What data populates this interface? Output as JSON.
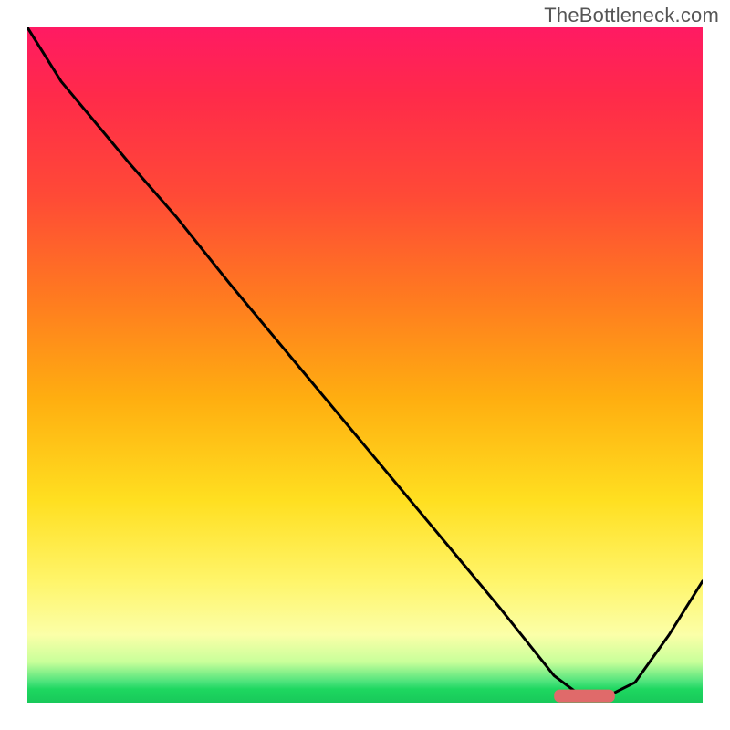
{
  "watermark": "TheBottleneck.com",
  "chart_data": {
    "type": "line",
    "title": "",
    "xlabel": "",
    "ylabel": "",
    "xlim": [
      0,
      100
    ],
    "ylim": [
      0,
      100
    ],
    "grid": false,
    "legend": false,
    "series": [
      {
        "name": "bottleneck-curve",
        "x": [
          0,
          5,
          15,
          22,
          30,
          40,
          50,
          60,
          70,
          78,
          82,
          86,
          90,
          95,
          100
        ],
        "y": [
          100,
          92,
          80,
          72,
          62,
          50,
          38,
          26,
          14,
          4,
          1,
          1,
          3,
          10,
          18
        ]
      }
    ],
    "annotations": [
      {
        "name": "optimal-band",
        "shape": "rounded-bar",
        "x_start": 78,
        "x_end": 87,
        "y": 1,
        "color": "#e06a6a"
      }
    ],
    "background_gradient_stops": [
      {
        "pos": 0.0,
        "color": "#ff1a63"
      },
      {
        "pos": 0.1,
        "color": "#ff2a4a"
      },
      {
        "pos": 0.25,
        "color": "#ff4a36"
      },
      {
        "pos": 0.4,
        "color": "#ff7a20"
      },
      {
        "pos": 0.55,
        "color": "#ffae10"
      },
      {
        "pos": 0.7,
        "color": "#ffdf20"
      },
      {
        "pos": 0.82,
        "color": "#fff56a"
      },
      {
        "pos": 0.9,
        "color": "#fbffa8"
      },
      {
        "pos": 0.94,
        "color": "#c8ff9a"
      },
      {
        "pos": 0.97,
        "color": "#49e27a"
      },
      {
        "pos": 0.98,
        "color": "#1ed760"
      },
      {
        "pos": 1.0,
        "color": "#18c95a"
      }
    ]
  }
}
